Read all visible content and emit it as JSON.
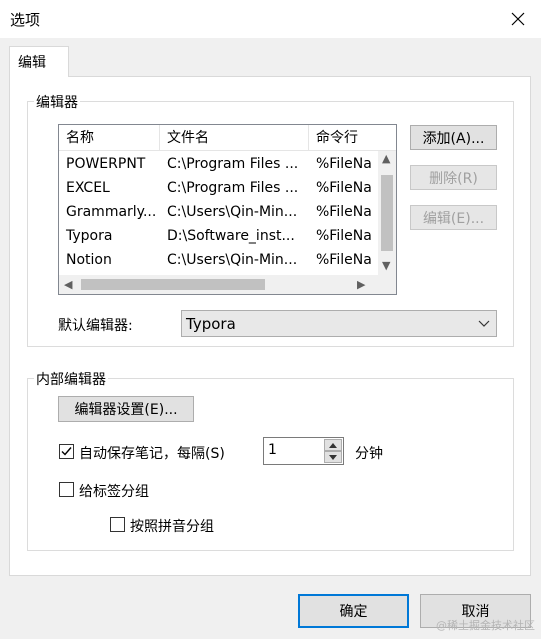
{
  "window": {
    "title": "选项"
  },
  "tabs": [
    {
      "label": "编辑"
    }
  ],
  "editors_group": {
    "legend": "编辑器",
    "columns": [
      "名称",
      "文件名",
      "命令行"
    ],
    "rows": [
      {
        "name": "POWERPNT",
        "file": "C:\\Program Files ...",
        "cmd": "%FileNa"
      },
      {
        "name": "EXCEL",
        "file": "C:\\Program Files ...",
        "cmd": "%FileNa"
      },
      {
        "name": "Grammarly...",
        "file": "C:\\Users\\Qin-Min...",
        "cmd": "%FileNa"
      },
      {
        "name": "Typora",
        "file": "D:\\Software_inst...",
        "cmd": "%FileNa"
      },
      {
        "name": "Notion",
        "file": "C:\\Users\\Qin-Min...",
        "cmd": "%FileNa"
      }
    ],
    "buttons": {
      "add": "添加(A)...",
      "delete": "删除(R)",
      "edit": "编辑(E)..."
    },
    "default_label": "默认编辑器:",
    "default_value": "Typora"
  },
  "internal_group": {
    "legend": "内部编辑器",
    "settings_button": "编辑器设置(E)...",
    "autosave_label": "自动保存笔记，每隔(S)",
    "autosave_checked": true,
    "autosave_interval": "1",
    "minutes_label": "分钟",
    "group_by_tag_label": "给标签分组",
    "group_by_tag_checked": false,
    "pinyin_label": "按照拼音分组",
    "pinyin_checked": false
  },
  "footer": {
    "ok": "确定",
    "cancel": "取消"
  },
  "watermark": "@稀土掘金技术社区",
  "colors": {
    "accent": "#0078d7"
  }
}
